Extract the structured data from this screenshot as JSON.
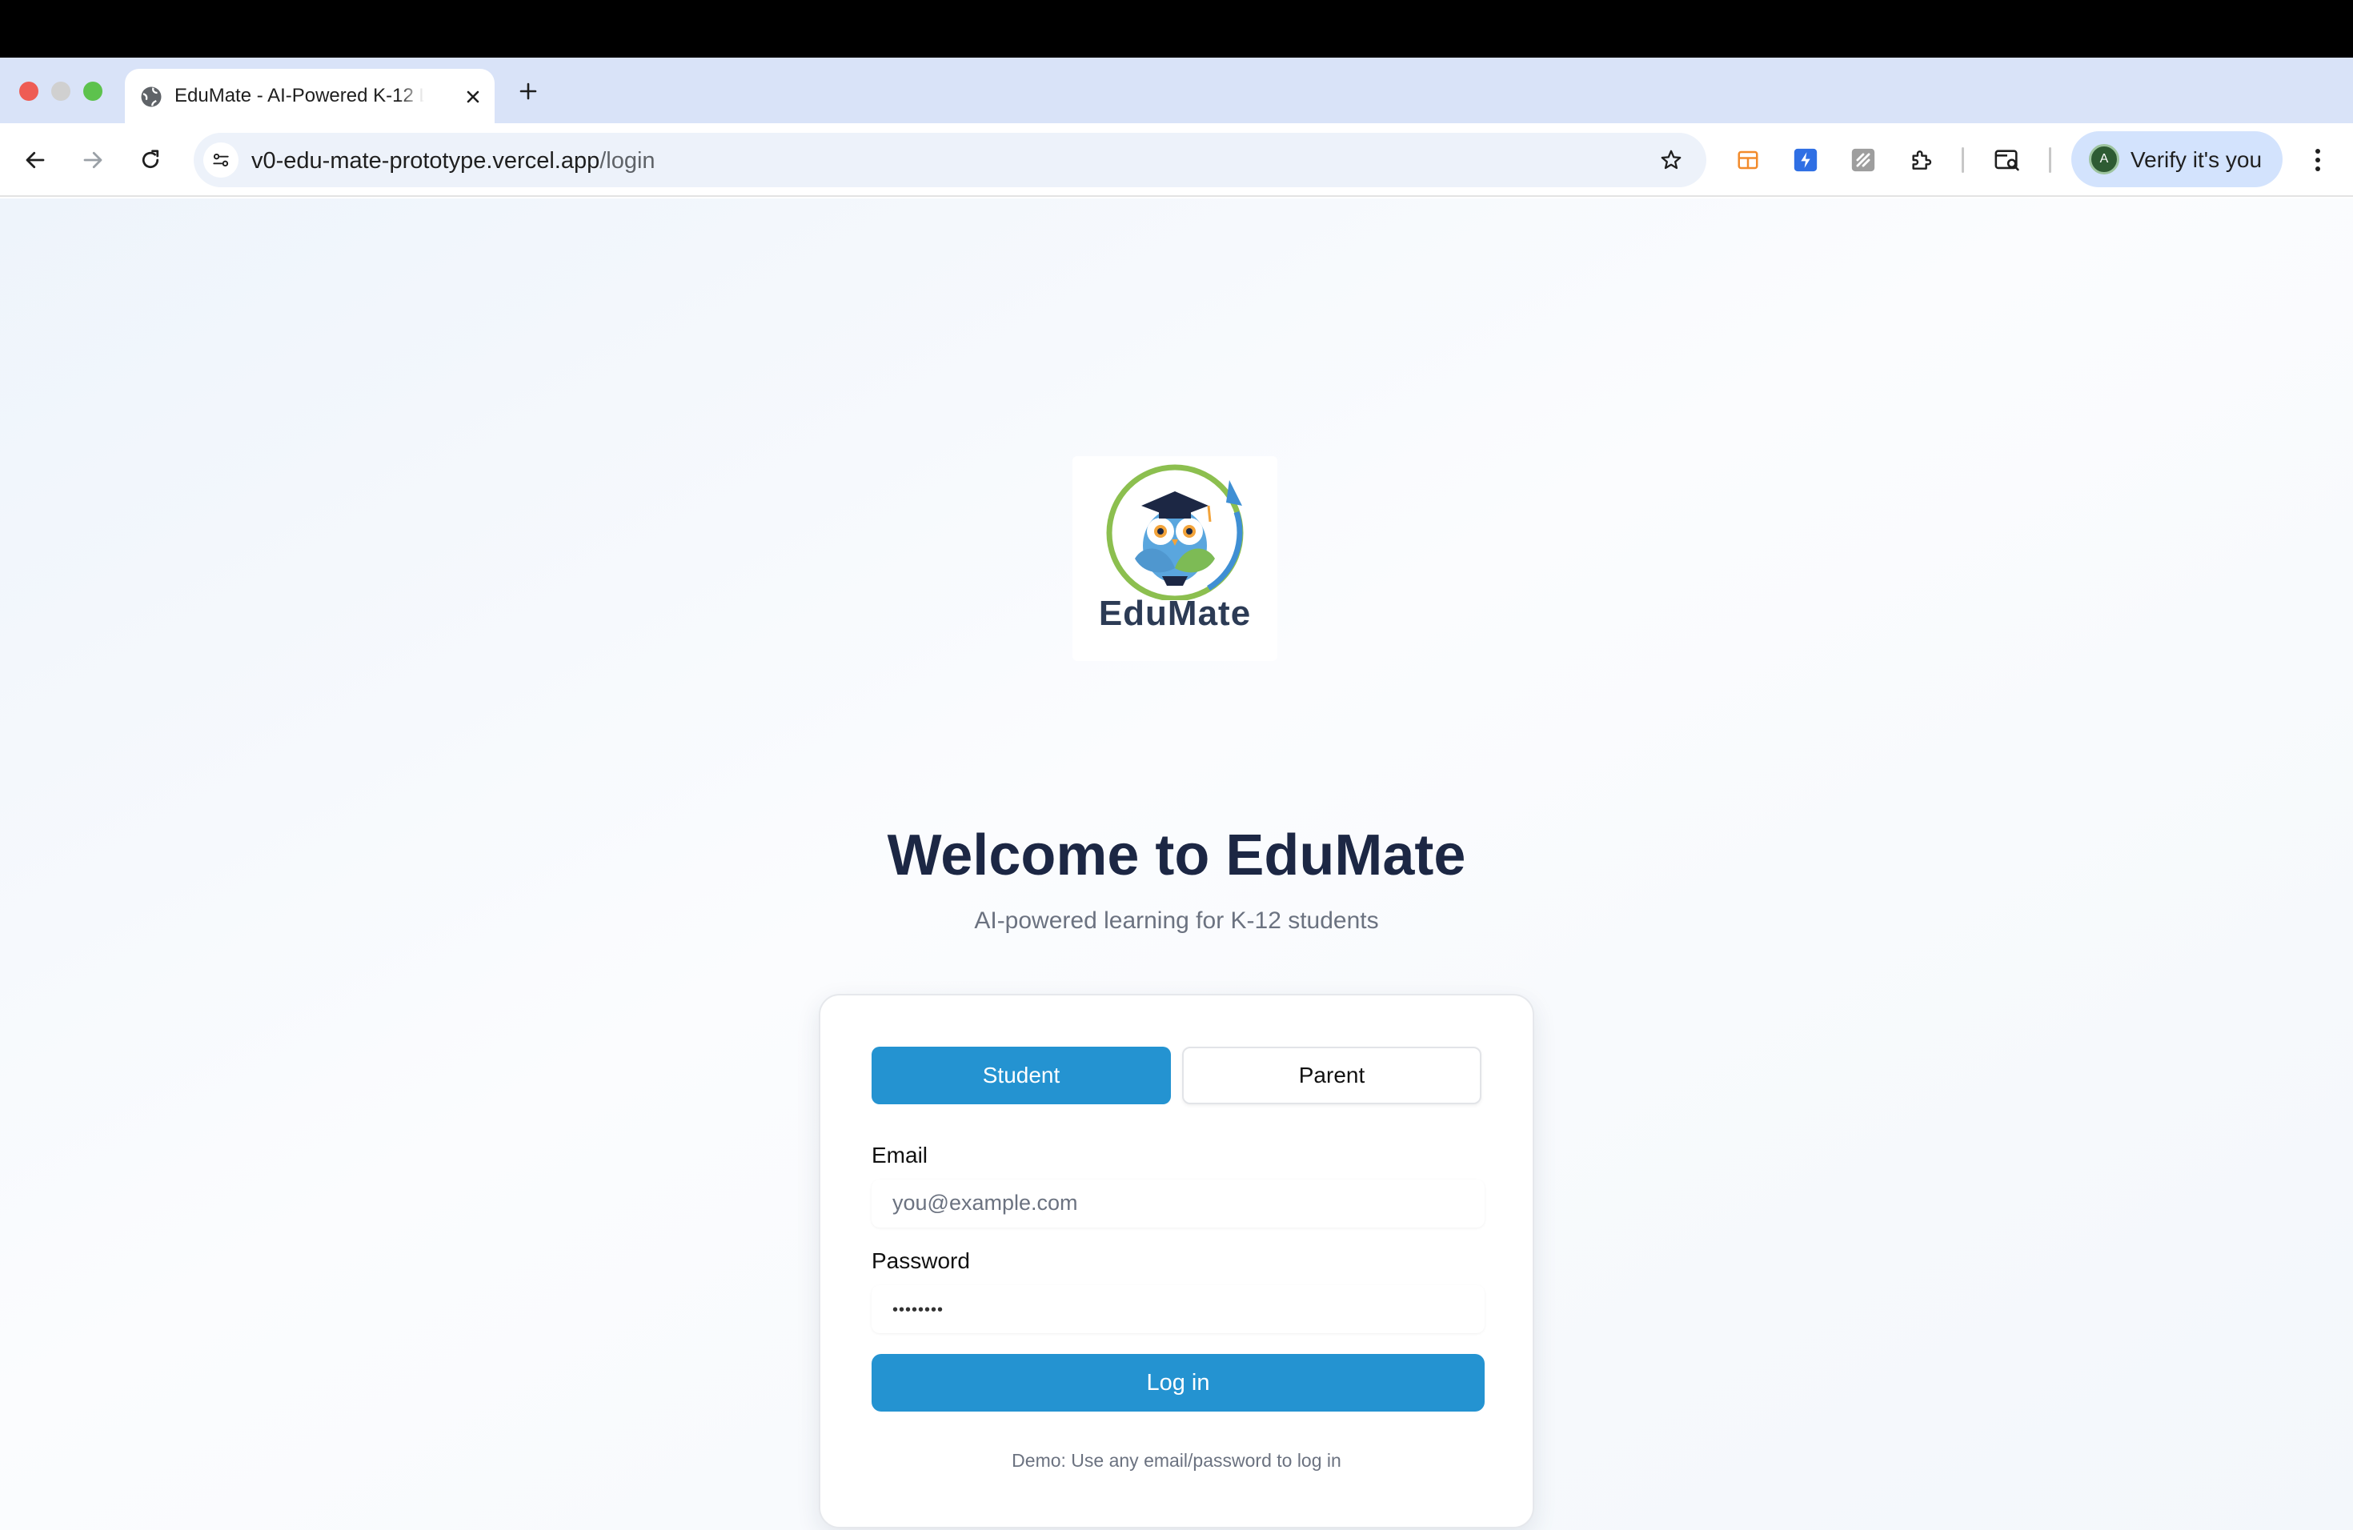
{
  "browser": {
    "tab": {
      "title": "EduMate - AI-Powered K-12 L",
      "favicon": "globe-icon"
    },
    "url": {
      "host": "v0-edu-mate-prototype.vercel.app",
      "path": "/login"
    },
    "profile": {
      "avatar_letter": "A",
      "label": "Verify it's you"
    },
    "icons": [
      "back-arrow-icon",
      "forward-arrow-icon",
      "reload-icon",
      "site-settings-icon",
      "bookmark-star-icon",
      "extension-icons",
      "puzzle-icon",
      "tab-search-icon",
      "kebab-menu-icon"
    ]
  },
  "page": {
    "logo": {
      "wordmark": "EduMate"
    },
    "title": "Welcome to EduMate",
    "subtitle": "AI-powered learning for K-12 students",
    "roles": {
      "student": "Student",
      "parent": "Parent",
      "selected": "Student"
    },
    "email": {
      "label": "Email",
      "placeholder": "you@example.com"
    },
    "password": {
      "label": "Password",
      "masked_value": "••••••••"
    },
    "login_label": "Log in",
    "demo_note": "Demo: Use any email/password to log in"
  },
  "colors": {
    "primary": "#2493d1",
    "heading": "#1c2744",
    "tabstrip": "#d9e3f8"
  }
}
